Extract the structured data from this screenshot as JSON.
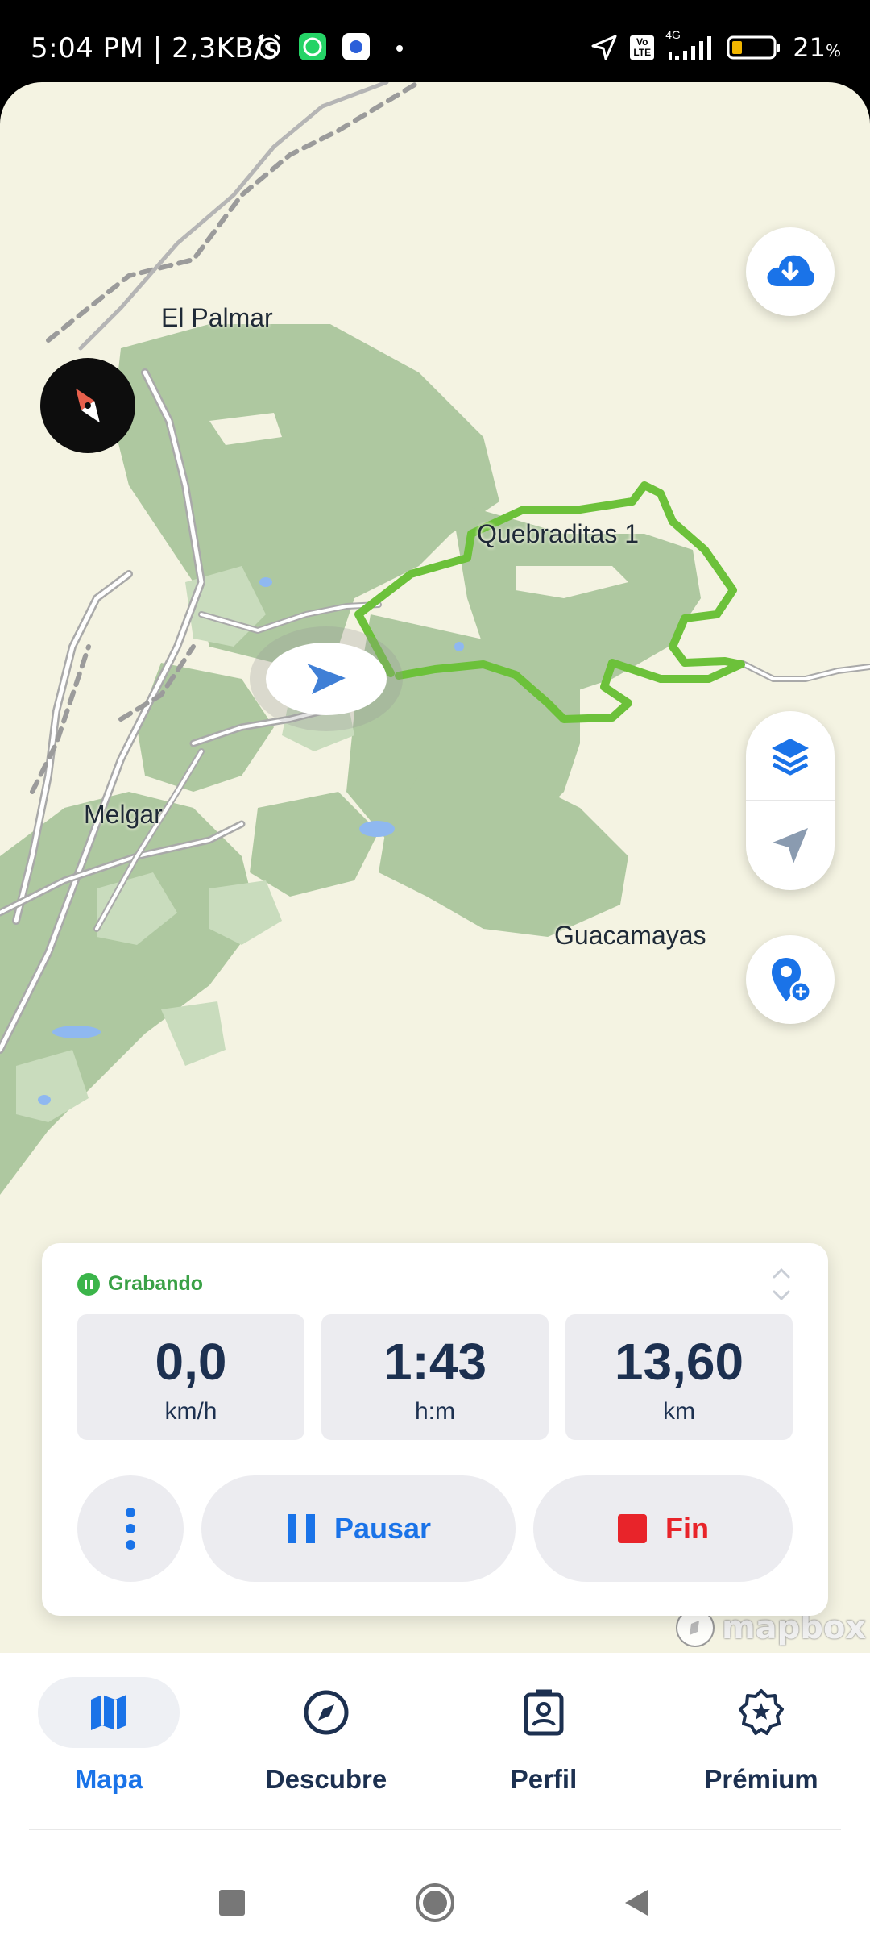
{
  "status_bar": {
    "time_and_speed": "5:04 PM | 2,3KB/s",
    "network": "4G",
    "volte": "Vo LTE",
    "battery": "21",
    "battery_unit": "%",
    "icons": [
      "alarm-icon",
      "whatsapp-icon",
      "app-icon",
      "dot-icon",
      "location-arrow-icon",
      "signal-icon",
      "battery-icon"
    ]
  },
  "map": {
    "places": [
      "El Palmar",
      "Quebraditas 1",
      "Melgar",
      "Guacamayas"
    ],
    "attribution": "mapbox",
    "controls": [
      "download-icon",
      "layers-icon",
      "navigation-arrow-icon",
      "add-location-icon",
      "compass-icon"
    ]
  },
  "recording": {
    "status": "Grabando",
    "stats": [
      {
        "value": "0,0",
        "unit": "km/h"
      },
      {
        "value": "1:43",
        "unit": "h:m"
      },
      {
        "value": "13,60",
        "unit": "km"
      }
    ],
    "pause_label": "Pausar",
    "end_label": "Fin"
  },
  "nav": {
    "items": [
      {
        "label": "Mapa",
        "icon": "map-icon",
        "active": true
      },
      {
        "label": "Descubre",
        "icon": "compass-icon",
        "active": false
      },
      {
        "label": "Perfil",
        "icon": "profile-icon",
        "active": false
      },
      {
        "label": "Prémium",
        "icon": "premium-badge-icon",
        "active": false
      }
    ]
  },
  "colors": {
    "accent": "#1a73e8",
    "recording_green": "#3bb54a",
    "route_green": "#6cc13a",
    "stop_red": "#e8242a",
    "text_dark": "#1c3050",
    "map_land": "#f4f3e2",
    "map_forest": "#aec8a0"
  }
}
